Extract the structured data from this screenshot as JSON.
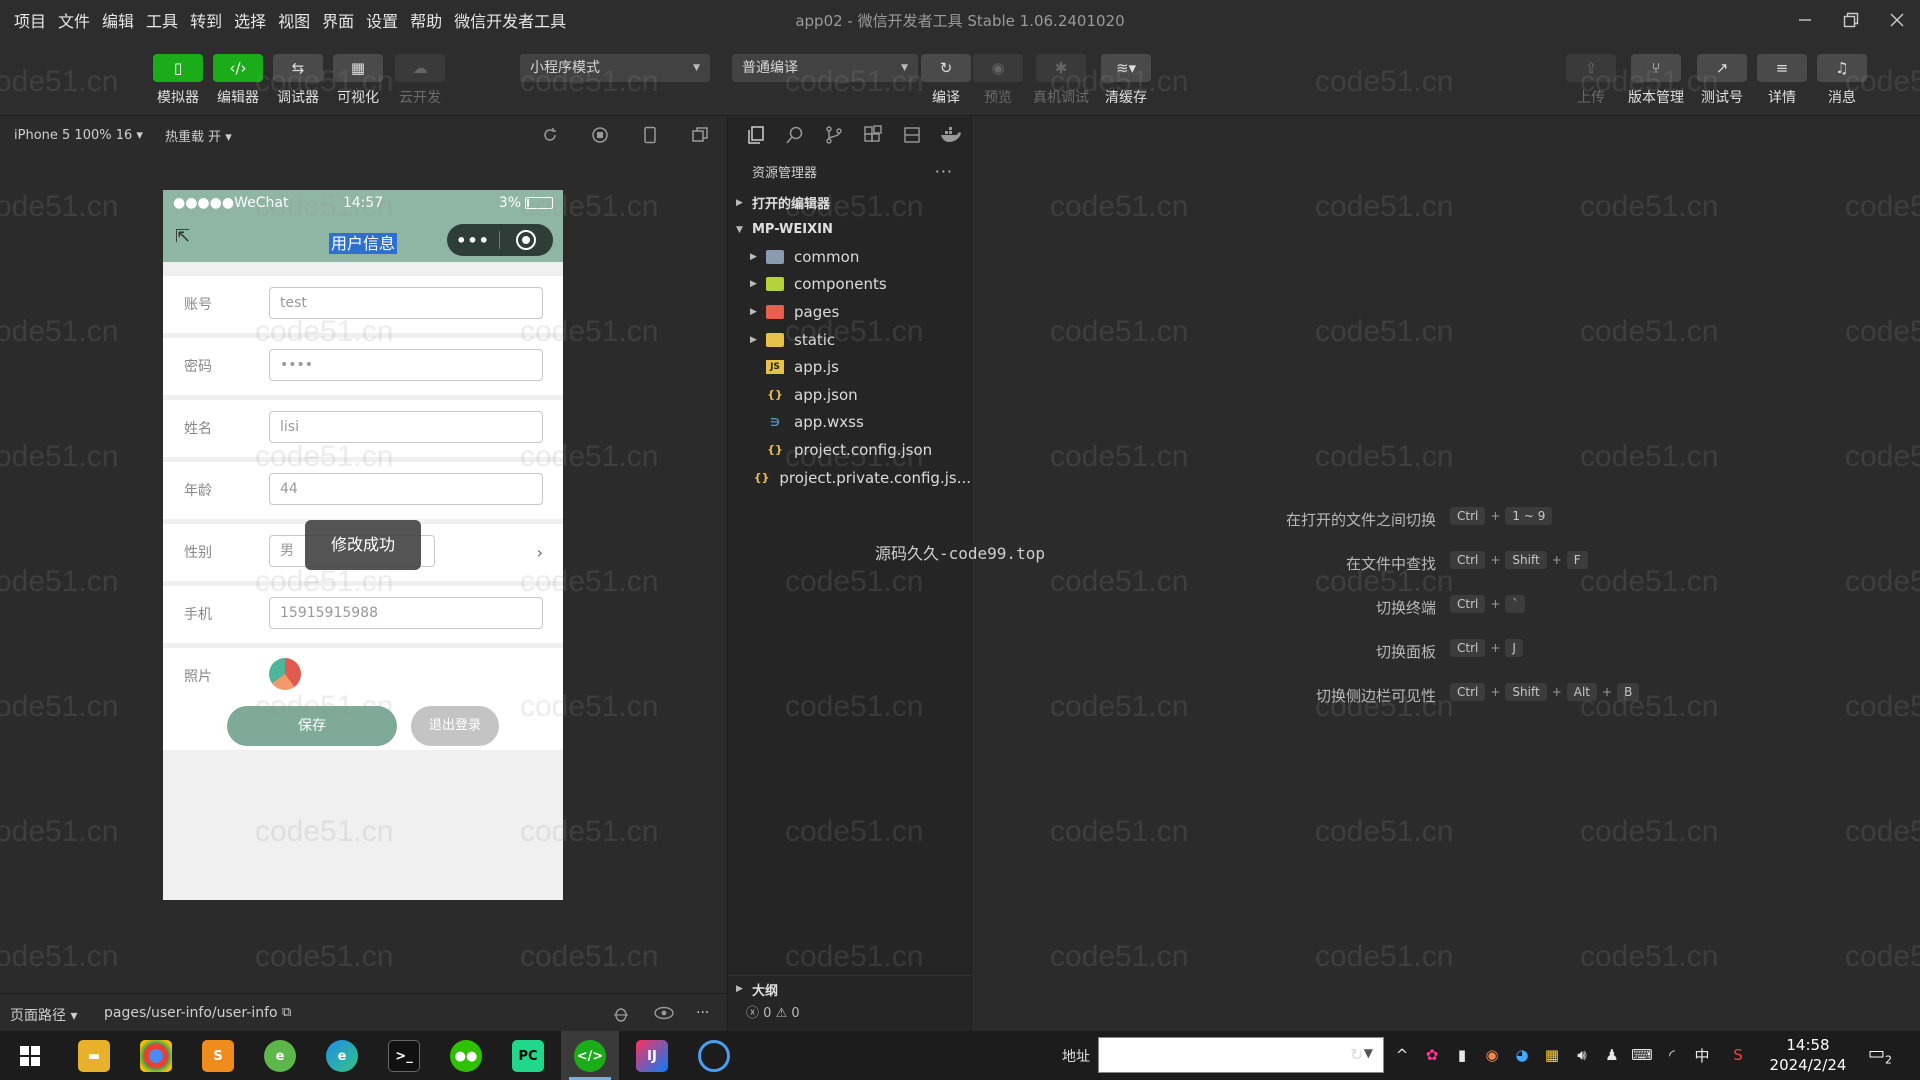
{
  "menu": [
    "项目",
    "文件",
    "编辑",
    "工具",
    "转到",
    "选择",
    "视图",
    "界面",
    "设置",
    "帮助",
    "微信开发者工具"
  ],
  "window_title": "app02 - 微信开发者工具 Stable 1.06.2401020",
  "toolbar": {
    "left_buttons": [
      {
        "label": "模拟器",
        "icon": "phone-icon",
        "style": "green"
      },
      {
        "label": "编辑器",
        "icon": "code-icon",
        "style": "green"
      },
      {
        "label": "调试器",
        "icon": "debug-icon",
        "style": "normal"
      },
      {
        "label": "可视化",
        "icon": "layout-icon",
        "style": "normal"
      },
      {
        "label": "云开发",
        "icon": "cloud-icon",
        "style": "dim"
      }
    ],
    "mode_select": "小程序模式",
    "compile_select": "普通编译",
    "mid_buttons": [
      {
        "label": "编译",
        "icon": "refresh-icon",
        "style": "normal"
      },
      {
        "label": "预览",
        "icon": "eye-icon",
        "style": "dim"
      },
      {
        "label": "真机调试",
        "icon": "bug-icon",
        "style": "dim"
      },
      {
        "label": "清缓存",
        "icon": "layers-icon",
        "style": "normal"
      }
    ],
    "right_buttons": [
      {
        "label": "上传",
        "icon": "upload-icon",
        "style": "dim"
      },
      {
        "label": "版本管理",
        "icon": "branch-icon",
        "style": "normal"
      },
      {
        "label": "测试号",
        "icon": "external-icon",
        "style": "normal"
      },
      {
        "label": "详情",
        "icon": "menu-icon",
        "style": "normal"
      },
      {
        "label": "消息",
        "icon": "bell-icon",
        "style": "normal"
      }
    ]
  },
  "sim_bar": {
    "device": "iPhone 5 100% 16 ▾",
    "hot_reload": "热重载 开 ▾"
  },
  "phone": {
    "carrier": "●●●●●WeChat",
    "time": "14:57",
    "battery": "3%",
    "nav_title": "用户信息",
    "capsule_dots": "•••",
    "fields": [
      {
        "label": "账号",
        "value": "test"
      },
      {
        "label": "密码",
        "value": "••••"
      },
      {
        "label": "姓名",
        "value": "lisi"
      },
      {
        "label": "年龄",
        "value": "44"
      },
      {
        "label": "性别",
        "value": "男"
      },
      {
        "label": "手机",
        "value": "15915915988"
      },
      {
        "label": "照片",
        "value": ""
      }
    ],
    "toast": "修改成功",
    "save_label": "保存",
    "logout_label": "退出登录"
  },
  "page_path": {
    "label": "页面路径 ▾",
    "path": "pages/user-info/user-info"
  },
  "explorer": {
    "title": "资源管理器",
    "more": "···",
    "open_editors": "打开的编辑器",
    "project": "MP-WEIXIN",
    "items": [
      {
        "name": "common",
        "type": "folder",
        "icon": "folder-icon",
        "color": "#8a9bb0"
      },
      {
        "name": "components",
        "type": "folder",
        "icon": "folder-icon",
        "color": "#b6d23a"
      },
      {
        "name": "pages",
        "type": "folder",
        "icon": "folder-icon",
        "color": "#e8604c"
      },
      {
        "name": "static",
        "type": "folder",
        "icon": "folder-icon",
        "color": "#e8c04c"
      },
      {
        "name": "app.js",
        "type": "file",
        "icon": "js-file-icon",
        "color": "#e8c04c"
      },
      {
        "name": "app.json",
        "type": "file",
        "icon": "json-file-icon",
        "color": "#e8c04c"
      },
      {
        "name": "app.wxss",
        "type": "file",
        "icon": "css-file-icon",
        "color": "#519aba"
      },
      {
        "name": "project.config.json",
        "type": "file",
        "icon": "json-file-icon",
        "color": "#e8c04c"
      },
      {
        "name": "project.private.config.js...",
        "type": "file",
        "icon": "json-file-icon",
        "color": "#e8c04c"
      }
    ],
    "outline": "大纲",
    "errors": "0",
    "warnings": "0"
  },
  "shortcuts": [
    {
      "label": "在打开的文件之间切换",
      "keys": [
        "Ctrl",
        "1 ~ 9"
      ]
    },
    {
      "label": "在文件中查找",
      "keys": [
        "Ctrl",
        "Shift",
        "F"
      ]
    },
    {
      "label": "切换终端",
      "keys": [
        "Ctrl",
        "`"
      ]
    },
    {
      "label": "切换面板",
      "keys": [
        "Ctrl",
        "J"
      ]
    },
    {
      "label": "切换侧边栏可见性",
      "keys": [
        "Ctrl",
        "Shift",
        "Alt",
        "B"
      ]
    }
  ],
  "center_text": "源码久久-code99.top",
  "watermark": "code51.cn",
  "taskbar": {
    "address_label": "地址",
    "time": "14:58",
    "date": "2024/2/24",
    "ime": "中",
    "notification_count": "2"
  }
}
